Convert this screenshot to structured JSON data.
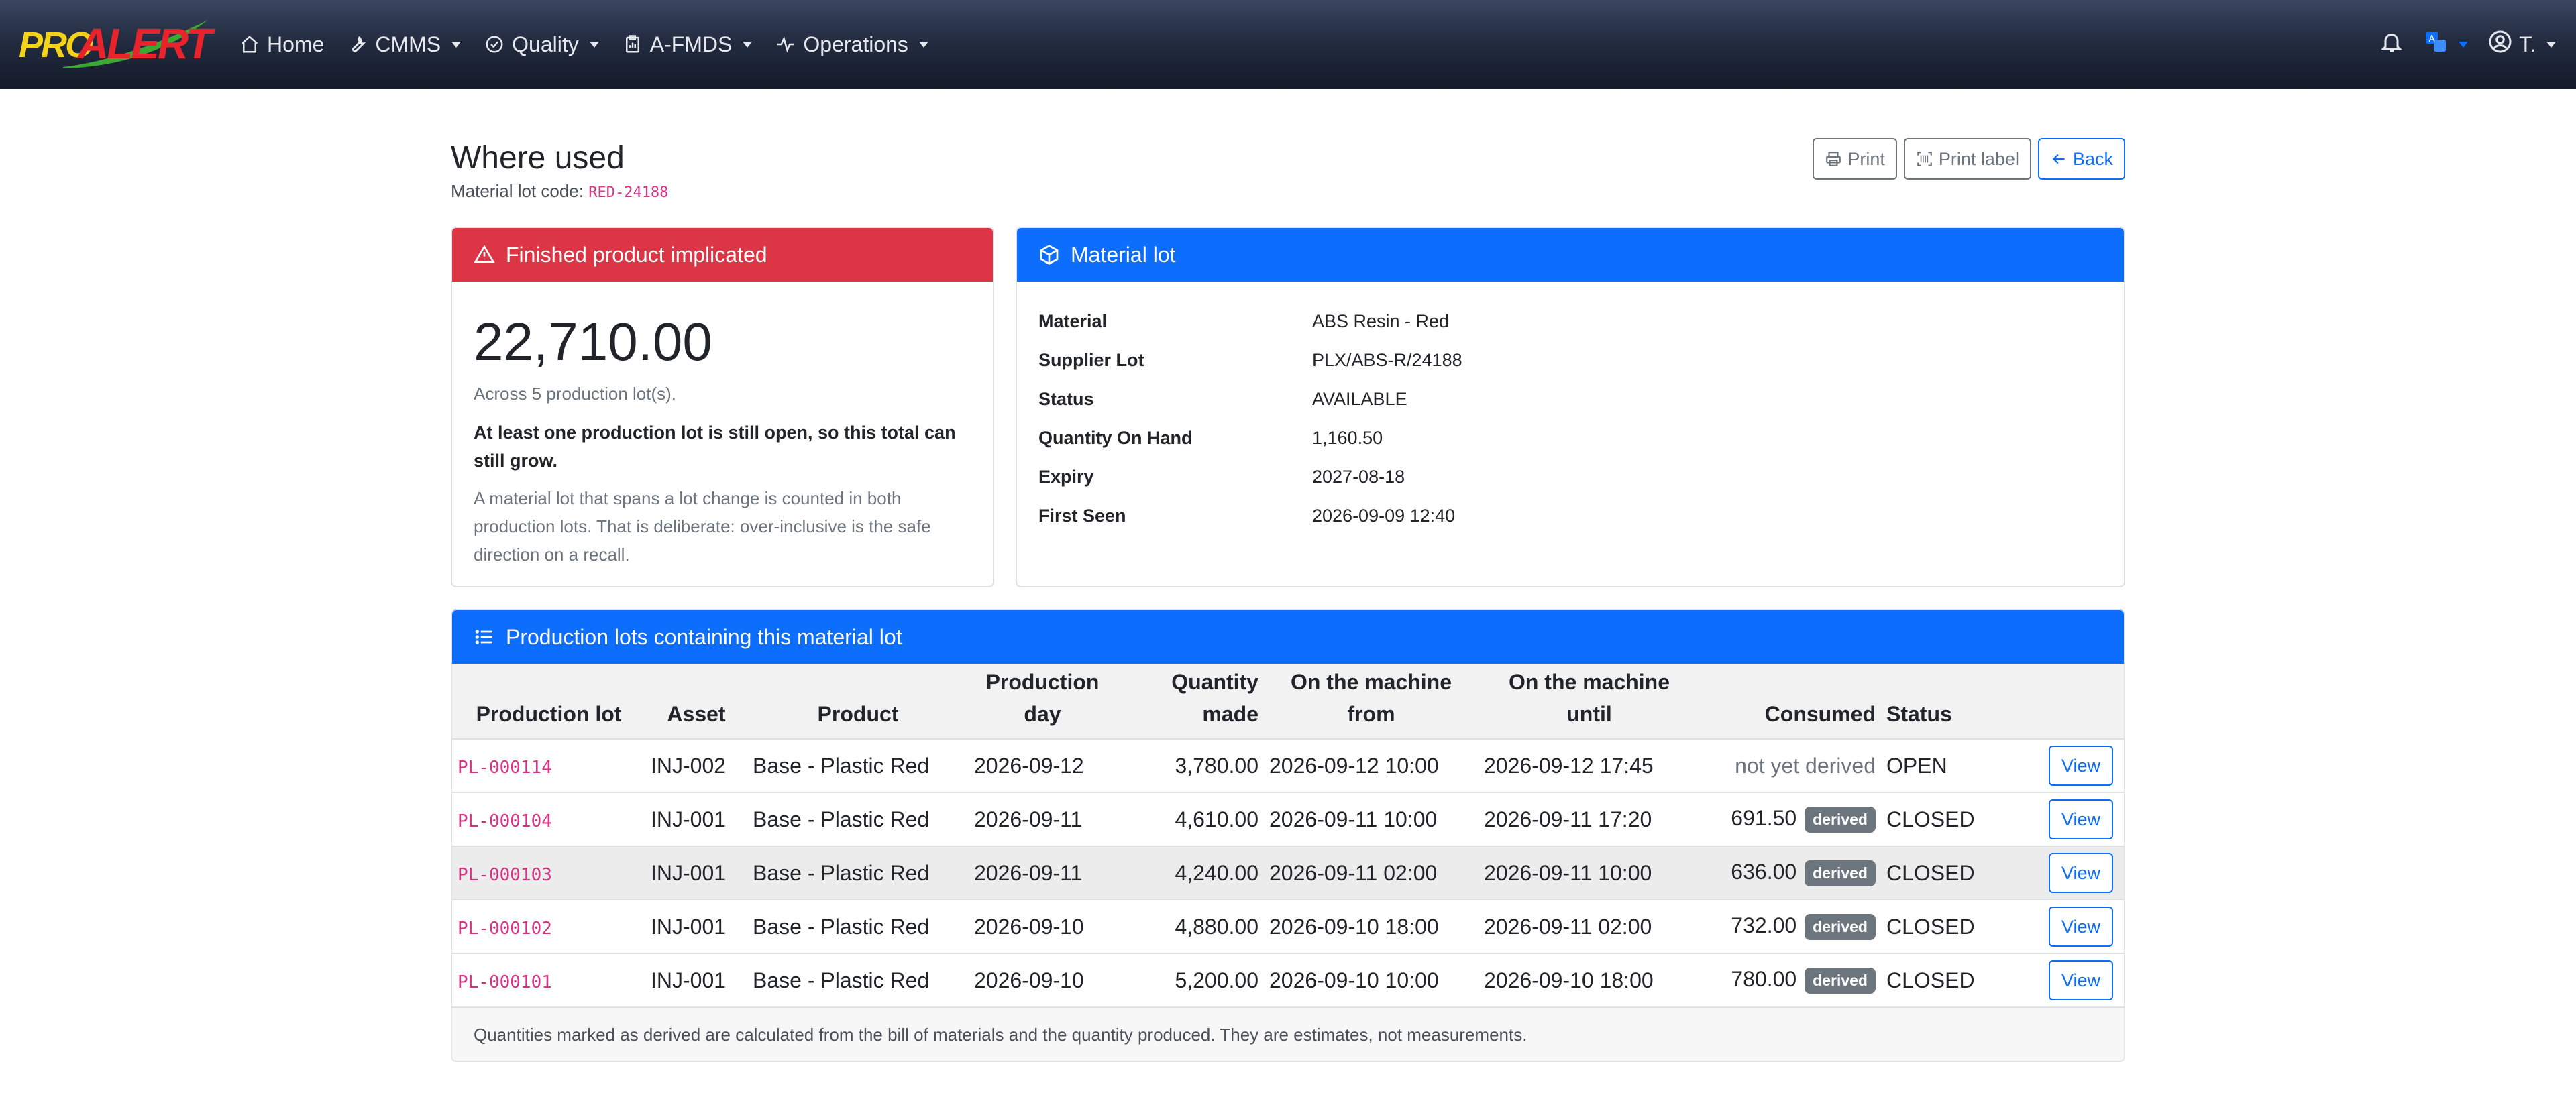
{
  "nav": {
    "logo_pro": "PRO",
    "logo_alert": "ALERT",
    "items": [
      {
        "label": "Home",
        "icon": "home-icon"
      },
      {
        "label": "CMMS",
        "icon": "wrench-icon"
      },
      {
        "label": "Quality",
        "icon": "check-circle-icon"
      },
      {
        "label": "A-FMDS",
        "icon": "clipboard-icon"
      },
      {
        "label": "Operations",
        "icon": "activity-icon"
      }
    ],
    "user": "T."
  },
  "page": {
    "title": "Where used",
    "subtitle_label": "Material lot code:",
    "subtitle_code": "RED-24188"
  },
  "buttons": {
    "print": "Print",
    "print_label": "Print label",
    "back": "Back"
  },
  "finished": {
    "header": "Finished product implicated",
    "total": "22,710.00",
    "across": "Across 5 production lot(s).",
    "warning": "At least one production lot is still open, so this total can still grow.",
    "note": "A material lot that spans a lot change is counted in both production lots. That is deliberate: over-inclusive is the safe direction on a recall."
  },
  "material": {
    "header": "Material lot",
    "rows": [
      {
        "k": "Material",
        "v": "ABS Resin - Red"
      },
      {
        "k": "Supplier Lot",
        "v": "PLX/ABS-R/24188"
      },
      {
        "k": "Status",
        "v": "AVAILABLE"
      },
      {
        "k": "Quantity On Hand",
        "v": "1,160.50"
      },
      {
        "k": "Expiry",
        "v": "2027-08-18"
      },
      {
        "k": "First Seen",
        "v": "2026-09-09 12:40"
      }
    ]
  },
  "production": {
    "header": "Production lots containing this material lot",
    "columns": {
      "lot": "Production lot",
      "asset": "Asset",
      "product": "Product",
      "day_1": "Production",
      "day_2": "day",
      "qty_1": "Quantity",
      "qty_2": "made",
      "from_1": "On the machine",
      "from_2": "from",
      "until_1": "On the machine",
      "until_2": "until",
      "consumed": "Consumed",
      "status": "Status"
    },
    "rows": [
      {
        "lot": "PL-000114",
        "asset": "INJ-002",
        "product": "Base - Plastic Red",
        "day": "2026-09-12",
        "qty": "3,780.00",
        "from": "2026-09-12 10:00",
        "until": "2026-09-12 17:45",
        "consumed": "not yet derived",
        "badge": "",
        "status": "OPEN",
        "view": "View"
      },
      {
        "lot": "PL-000104",
        "asset": "INJ-001",
        "product": "Base - Plastic Red",
        "day": "2026-09-11",
        "qty": "4,610.00",
        "from": "2026-09-11 10:00",
        "until": "2026-09-11 17:20",
        "consumed": "691.50",
        "badge": "derived",
        "status": "CLOSED",
        "view": "View"
      },
      {
        "lot": "PL-000103",
        "asset": "INJ-001",
        "product": "Base - Plastic Red",
        "day": "2026-09-11",
        "qty": "4,240.00",
        "from": "2026-09-11 02:00",
        "until": "2026-09-11 10:00",
        "consumed": "636.00",
        "badge": "derived",
        "status": "CLOSED",
        "view": "View"
      },
      {
        "lot": "PL-000102",
        "asset": "INJ-001",
        "product": "Base - Plastic Red",
        "day": "2026-09-10",
        "qty": "4,880.00",
        "from": "2026-09-10 18:00",
        "until": "2026-09-11 02:00",
        "consumed": "732.00",
        "badge": "derived",
        "status": "CLOSED",
        "view": "View"
      },
      {
        "lot": "PL-000101",
        "asset": "INJ-001",
        "product": "Base - Plastic Red",
        "day": "2026-09-10",
        "qty": "5,200.00",
        "from": "2026-09-10 10:00",
        "until": "2026-09-10 18:00",
        "consumed": "780.00",
        "badge": "derived",
        "status": "CLOSED",
        "view": "View"
      }
    ],
    "footer": "Quantities marked as derived are calculated from the bill of materials and the quantity produced. They are estimates, not measurements."
  },
  "colors": {
    "danger": "#dc3545",
    "primary": "#0d6efd",
    "code": "#d63384"
  }
}
